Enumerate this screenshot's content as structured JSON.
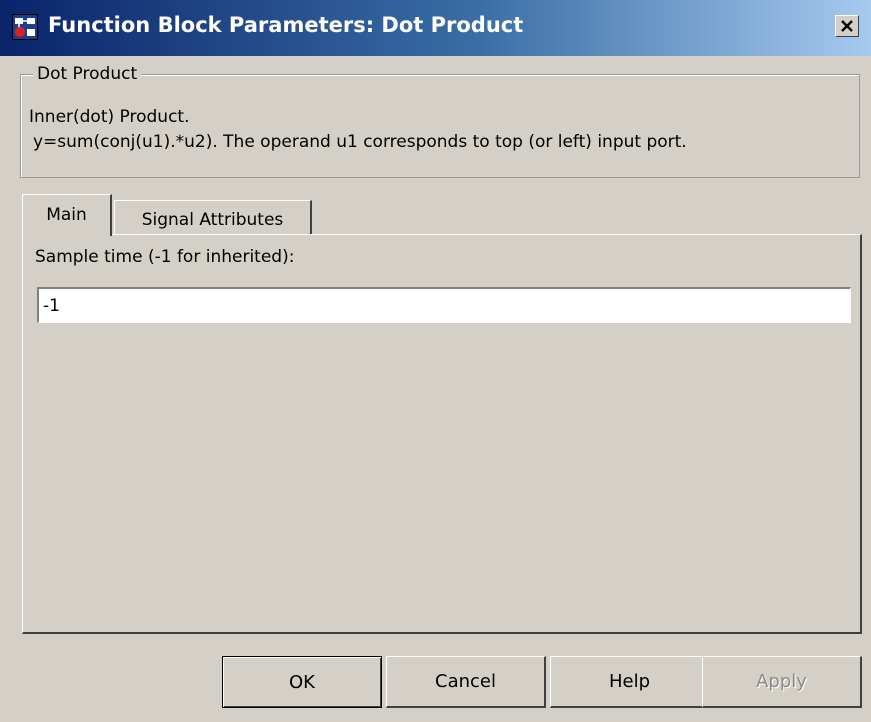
{
  "window": {
    "title": "Function Block Parameters: Dot Product",
    "app_icon": "simulink-block-icon",
    "close_icon": "close-icon"
  },
  "description_group": {
    "legend": "Dot Product",
    "line1": "Inner(dot) Product.",
    "line2": "y=sum(conj(u1).*u2). The operand u1 corresponds to top (or left) input port."
  },
  "tabs": [
    {
      "label": "Main",
      "selected": true
    },
    {
      "label": "Signal Attributes",
      "selected": false
    }
  ],
  "main_tab": {
    "sample_time_label": "Sample time (-1 for inherited):",
    "sample_time_value": "-1"
  },
  "buttons": {
    "ok": "OK",
    "cancel": "Cancel",
    "help": "Help",
    "apply": "Apply"
  },
  "colors": {
    "face": "#d4d0c8",
    "title_active_start": "#0a246a",
    "title_active_end": "#a6caf0",
    "disabled_text": "#8a8a8a"
  }
}
